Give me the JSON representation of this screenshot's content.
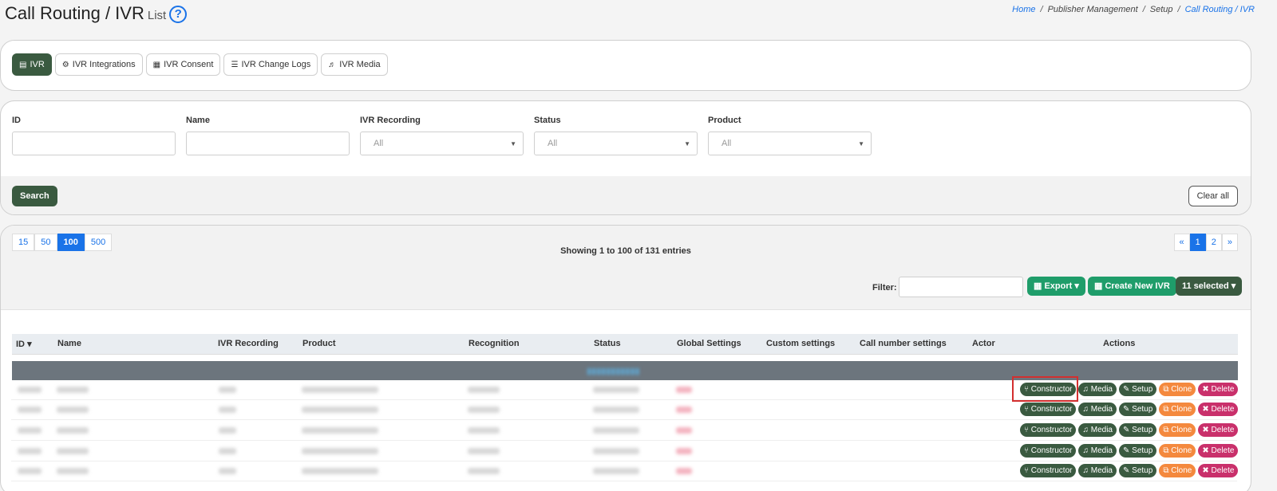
{
  "header": {
    "title": "Call Routing / IVR",
    "subtitle": "List",
    "help": "?"
  },
  "breadcrumb": [
    "Home",
    "Publisher Management",
    "Setup",
    "Call Routing / IVR"
  ],
  "tabs": [
    {
      "label": "IVR",
      "icon": "chart-icon"
    },
    {
      "label": "IVR Integrations",
      "icon": "cogs-icon"
    },
    {
      "label": "IVR Consent",
      "icon": "file-icon"
    },
    {
      "label": "IVR Change Logs",
      "icon": "list-icon"
    },
    {
      "label": "IVR Media",
      "icon": "volume-icon"
    }
  ],
  "filters": {
    "id": {
      "label": "ID",
      "value": ""
    },
    "name": {
      "label": "Name",
      "value": ""
    },
    "ivr_recording": {
      "label": "IVR Recording",
      "value": "All"
    },
    "status": {
      "label": "Status",
      "value": "All"
    },
    "product": {
      "label": "Product",
      "value": "All"
    },
    "search_label": "Search",
    "clear_label": "Clear all"
  },
  "table": {
    "page_sizes": [
      "15",
      "50",
      "100",
      "500"
    ],
    "active_page_size": "100",
    "showing": "Showing 1 to 100 of 131 entries",
    "pagination": [
      "«",
      "1",
      "2",
      "»"
    ],
    "filter_label": "Filter:",
    "export_label": "Export",
    "create_label": "Create New IVR",
    "selected_label": "11 selected",
    "columns": [
      "ID",
      "Name",
      "IVR Recording",
      "Product",
      "Recognition",
      "Status",
      "Global Settings",
      "Custom settings",
      "Call number settings",
      "Actor",
      "Actions"
    ],
    "actions": [
      "Constructor",
      "Media",
      "Setup",
      "Clone",
      "Delete"
    ]
  },
  "colors": {
    "primary_green": "#3a5a40",
    "export_green": "#1f9d6a",
    "link_blue": "#1a73e8",
    "clone_orange": "#f4893e",
    "delete_pink": "#c9306b",
    "highlight_red": "#d32f2f"
  }
}
